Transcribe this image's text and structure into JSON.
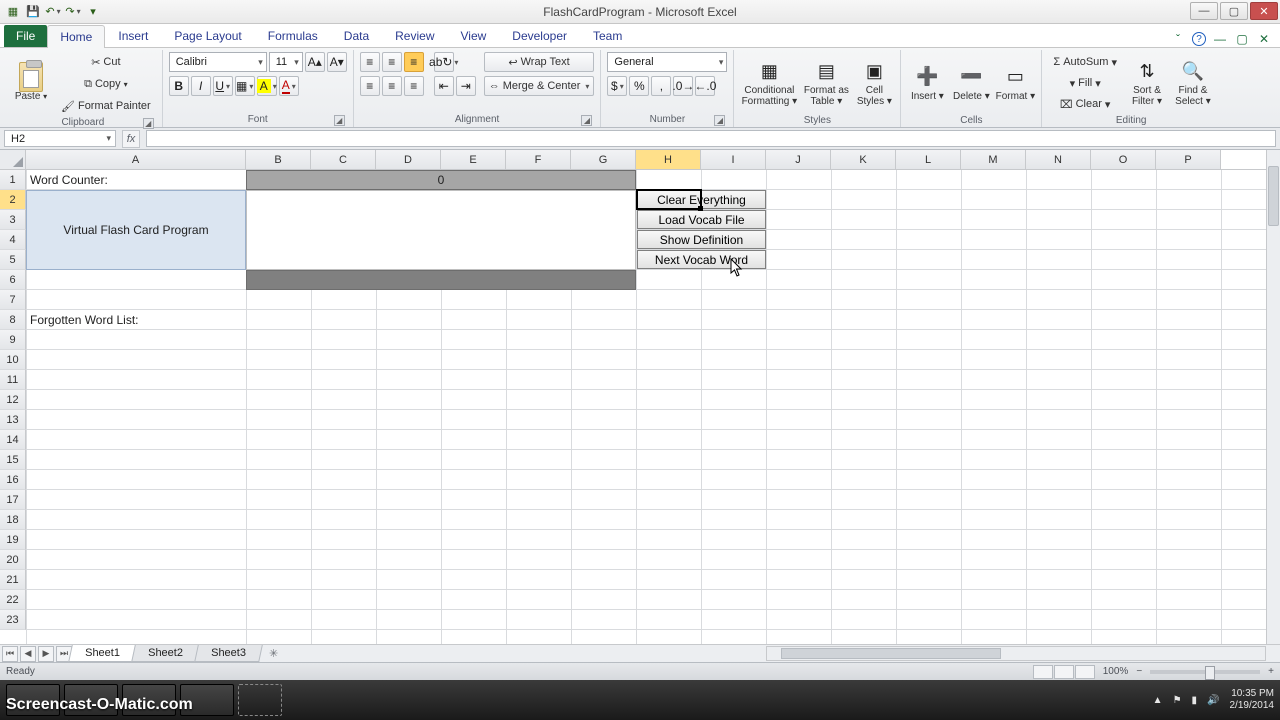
{
  "window": {
    "title_doc": "FlashCardProgram",
    "title_app": "Microsoft Excel"
  },
  "qat": {
    "save": "💾",
    "undo": "↶",
    "redo": "↷"
  },
  "tabs": {
    "file": "File",
    "home": "Home",
    "insert": "Insert",
    "page_layout": "Page Layout",
    "formulas": "Formulas",
    "data": "Data",
    "review": "Review",
    "view": "View",
    "developer": "Developer",
    "team": "Team"
  },
  "ribbon": {
    "clipboard": {
      "label": "Clipboard",
      "paste": "Paste",
      "cut": "Cut",
      "copy": "Copy",
      "fmtpaint": "Format Painter"
    },
    "font": {
      "label": "Font",
      "name": "Calibri",
      "size": "11"
    },
    "alignment": {
      "label": "Alignment",
      "wrap": "Wrap Text",
      "merge": "Merge & Center"
    },
    "number": {
      "label": "Number",
      "format": "General"
    },
    "styles": {
      "label": "Styles",
      "cond": "Conditional Formatting",
      "table": "Format as Table",
      "cell": "Cell Styles"
    },
    "cells": {
      "label": "Cells",
      "insert": "Insert",
      "delete": "Delete",
      "format": "Format"
    },
    "editing": {
      "label": "Editing",
      "autosum": "AutoSum",
      "fill": "Fill",
      "clear": "Clear",
      "sort": "Sort & Filter",
      "find": "Find & Select"
    }
  },
  "namebox": "H2",
  "columns": [
    "A",
    "B",
    "C",
    "D",
    "E",
    "F",
    "G",
    "H",
    "I",
    "J",
    "K",
    "L",
    "M",
    "N",
    "O",
    "P"
  ],
  "content": {
    "a1": "Word Counter:",
    "b1_value": "0",
    "flashcard_title": "Virtual Flash Card Program",
    "a8": "Forgotten Word List:",
    "btn_clear": "Clear Everything",
    "btn_load": "Load Vocab File",
    "btn_showdef": "Show Definition",
    "btn_next": "Next Vocab Word"
  },
  "sheets": {
    "s1": "Sheet1",
    "s2": "Sheet2",
    "s3": "Sheet3"
  },
  "status": {
    "ready": "Ready",
    "zoom": "100%"
  },
  "tray": {
    "time": "10:35 PM",
    "date": "2/19/2014"
  },
  "watermark": "Screencast-O-Matic.com"
}
